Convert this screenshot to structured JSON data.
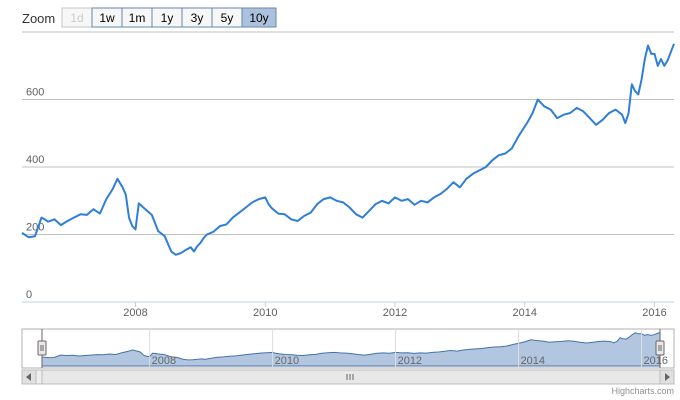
{
  "zoom": {
    "label": "Zoom",
    "buttons": [
      {
        "label": "1d",
        "state": "disabled"
      },
      {
        "label": "1w",
        "state": "normal"
      },
      {
        "label": "1m",
        "state": "normal"
      },
      {
        "label": "1y",
        "state": "normal"
      },
      {
        "label": "3y",
        "state": "normal"
      },
      {
        "label": "5y",
        "state": "normal"
      },
      {
        "label": "10y",
        "state": "active"
      }
    ]
  },
  "credits": "Highcharts.com",
  "colors": {
    "series": "#2f7ed8",
    "navigator_fill": "#b3c6e0",
    "navigator_line": "#4572a7",
    "grid": "#c0c0c0"
  },
  "chart_data": {
    "type": "line",
    "title": "",
    "xlabel": "",
    "ylabel": "",
    "xlim": [
      2006.25,
      2016.3
    ],
    "ylim": [
      0,
      800
    ],
    "yticks": [
      0,
      200,
      400,
      600
    ],
    "xticks": [
      2008,
      2010,
      2012,
      2014,
      2016
    ],
    "grid": true,
    "legend": "none",
    "series": [
      {
        "x": [
          2006.25,
          2006.35,
          2006.45,
          2006.55,
          2006.6,
          2006.65,
          2006.75,
          2006.85,
          2006.95,
          2007.05,
          2007.15,
          2007.25,
          2007.35,
          2007.45,
          2007.55,
          2007.65,
          2007.72,
          2007.8,
          2007.85,
          2007.9,
          2007.95,
          2008.0,
          2008.05,
          2008.15,
          2008.25,
          2008.35,
          2008.45,
          2008.55,
          2008.62,
          2008.7,
          2008.78,
          2008.85,
          2008.9,
          2008.95,
          2009.0,
          2009.05,
          2009.1,
          2009.2,
          2009.3,
          2009.4,
          2009.5,
          2009.6,
          2009.7,
          2009.8,
          2009.9,
          2010.0,
          2010.05,
          2010.1,
          2010.2,
          2010.3,
          2010.4,
          2010.5,
          2010.6,
          2010.7,
          2010.8,
          2010.9,
          2011.0,
          2011.1,
          2011.2,
          2011.3,
          2011.4,
          2011.5,
          2011.6,
          2011.7,
          2011.8,
          2011.9,
          2012.0,
          2012.1,
          2012.2,
          2012.3,
          2012.4,
          2012.5,
          2012.6,
          2012.7,
          2012.8,
          2012.9,
          2013.0,
          2013.1,
          2013.2,
          2013.3,
          2013.4,
          2013.5,
          2013.6,
          2013.7,
          2013.8,
          2013.9,
          2014.0,
          2014.05,
          2014.12,
          2014.2,
          2014.3,
          2014.4,
          2014.5,
          2014.6,
          2014.7,
          2014.8,
          2014.9,
          2015.0,
          2015.1,
          2015.2,
          2015.3,
          2015.4,
          2015.5,
          2015.55,
          2015.6,
          2015.65,
          2015.7,
          2015.75,
          2015.8,
          2015.85,
          2015.9,
          2015.95,
          2016.0,
          2016.05,
          2016.1,
          2016.15,
          2016.2,
          2016.3
        ],
        "y": [
          205,
          192,
          195,
          250,
          245,
          238,
          245,
          228,
          240,
          250,
          260,
          258,
          275,
          262,
          305,
          335,
          365,
          340,
          318,
          250,
          225,
          215,
          292,
          275,
          258,
          210,
          195,
          150,
          140,
          145,
          155,
          162,
          150,
          165,
          175,
          190,
          200,
          208,
          225,
          230,
          250,
          265,
          280,
          295,
          305,
          310,
          290,
          278,
          262,
          260,
          245,
          240,
          255,
          265,
          290,
          305,
          310,
          300,
          295,
          280,
          260,
          250,
          270,
          290,
          300,
          292,
          310,
          300,
          305,
          288,
          300,
          295,
          310,
          320,
          335,
          355,
          340,
          365,
          380,
          390,
          400,
          420,
          435,
          440,
          455,
          490,
          520,
          535,
          560,
          600,
          580,
          570,
          545,
          555,
          560,
          575,
          565,
          545,
          525,
          540,
          560,
          570,
          555,
          530,
          560,
          645,
          625,
          615,
          660,
          720,
          760,
          735,
          735,
          700,
          720,
          700,
          715,
          765
        ]
      }
    ],
    "navigator": {
      "xticks": [
        2008,
        2010,
        2012,
        2014,
        2016
      ]
    }
  }
}
